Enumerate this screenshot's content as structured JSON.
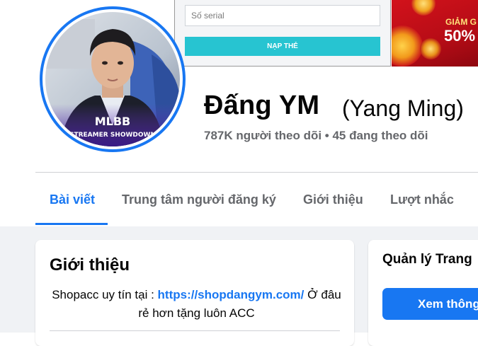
{
  "cover": {
    "serial_placeholder": "Số serial",
    "topup_label": "NẠP THẺ",
    "promo_line1": "GIẢM G",
    "promo_line2": "50%"
  },
  "profile": {
    "name": "Đấng YM",
    "alt_name": "(Yang Ming)",
    "stats": "787K người theo dõi • 45 đang theo dõi",
    "avatar_overlay_line1": "MLBB",
    "avatar_overlay_line2": "STREAMER SHOWDOWN"
  },
  "tabs": [
    {
      "label": "Bài viết",
      "active": true
    },
    {
      "label": "Trung tâm người đăng ký",
      "active": false
    },
    {
      "label": "Giới thiệu",
      "active": false
    },
    {
      "label": "Lượt nhắc",
      "active": false
    }
  ],
  "intro": {
    "title": "Giới thiệu",
    "bio_prefix": "Shopacc uy tín tại : ",
    "bio_link": "https://shopdangym.com/",
    "bio_suffix": " Ở đâu rẻ hơn tặng luôn ACC"
  },
  "manage": {
    "title": "Quản lý Trang",
    "button_label": "Xem thông"
  },
  "colors": {
    "accent": "#1877f2",
    "topup_button": "#27c4d1",
    "promo_red": "#d2121b",
    "page_bg": "#f0f2f5"
  }
}
